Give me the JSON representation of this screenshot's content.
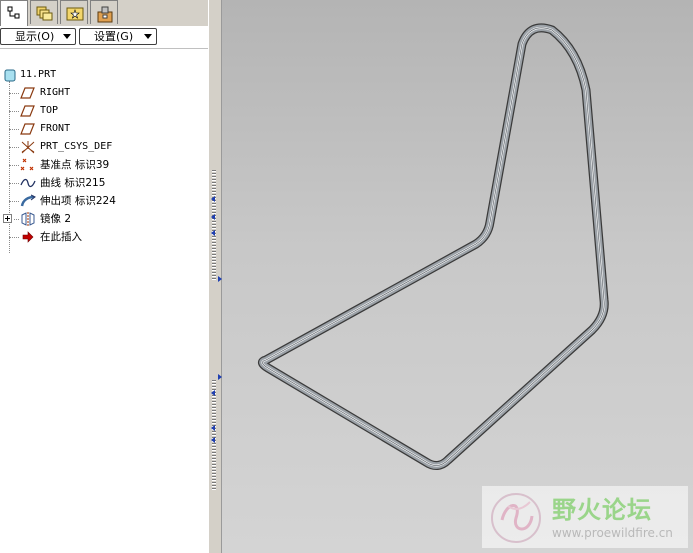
{
  "tabs": [
    {
      "icon": "model-tree-icon",
      "active": true
    },
    {
      "icon": "folder-browser-icon",
      "active": false
    },
    {
      "icon": "favorites-icon",
      "active": false
    },
    {
      "icon": "connections-icon",
      "active": false
    }
  ],
  "toolbar": {
    "show_label": "显示(O)",
    "settings_label": "设置(G)"
  },
  "tree": {
    "root": "11.PRT",
    "items": [
      {
        "icon": "datum-plane-icon",
        "label": "RIGHT"
      },
      {
        "icon": "datum-plane-icon",
        "label": "TOP"
      },
      {
        "icon": "datum-plane-icon",
        "label": "FRONT"
      },
      {
        "icon": "csys-icon",
        "label": "PRT_CSYS_DEF"
      },
      {
        "icon": "datum-point-icon",
        "label": "基准点 标识39"
      },
      {
        "icon": "curve-icon",
        "label": "曲线 标识215"
      },
      {
        "icon": "sweep-icon",
        "label": "伸出项 标识224"
      },
      {
        "icon": "mirror-icon",
        "label": "镜像 2"
      },
      {
        "icon": "insert-here-arrow-icon",
        "label": "在此插入"
      }
    ]
  },
  "watermark": {
    "title": "野火论坛",
    "url": "www.proewildfire.cn"
  },
  "colors": {
    "panel_bg": "#d4d0c8",
    "viewport_top": "#b4b4b4",
    "viewport_bottom": "#d4d4d4",
    "insert_arrow": "#c00000",
    "splitter_arrow": "#1f3fb0",
    "watermark_text": "#9ad58a"
  }
}
